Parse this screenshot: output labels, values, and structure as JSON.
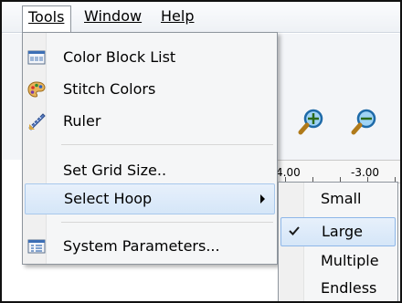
{
  "menubar": {
    "tools": "Tools",
    "window": "Window",
    "help": "Help"
  },
  "ruler": {
    "left": "4.00",
    "right": "-3.00"
  },
  "tools_menu": {
    "items": [
      {
        "label": "Color Block List",
        "icon": "color-block-list-icon"
      },
      {
        "label": "Stitch Colors",
        "icon": "palette-icon"
      },
      {
        "label": "Ruler",
        "icon": "ruler-icon"
      },
      {
        "label": "Set Grid Size.."
      },
      {
        "label": "Select Hoop",
        "has_submenu": true
      },
      {
        "label": "System Parameters...",
        "icon": "system-parameters-icon"
      }
    ]
  },
  "hoop_submenu": {
    "items": [
      {
        "label": "Small",
        "checked": false
      },
      {
        "label": "Large",
        "checked": true
      },
      {
        "label": "Multiple",
        "checked": false
      },
      {
        "label": "Endless",
        "checked": false
      }
    ]
  },
  "colors": {
    "highlight": "#d5e6f8",
    "highlight_border": "#a8c8ec",
    "menu_bg": "#f5f6f7"
  }
}
